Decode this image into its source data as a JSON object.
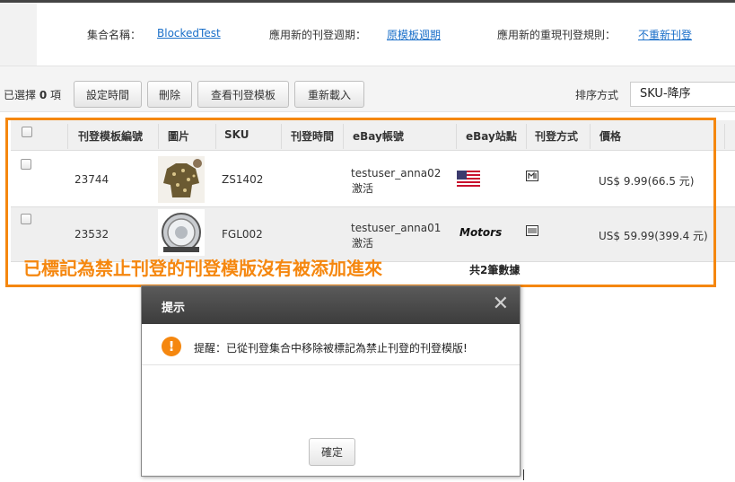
{
  "header": {
    "collection_label": "集合名稱：",
    "collection_value": "BlockedTest",
    "cycle_label": "應用新的刊登週期：",
    "cycle_value": "原模板週期",
    "rule_label": "應用新的重現刊登規則：",
    "rule_value": "不重新刊登"
  },
  "toolbar": {
    "selected_prefix": "已選擇",
    "selected_count": "0",
    "selected_suffix": "項",
    "buttons": [
      "設定時間",
      "刪除",
      "查看刊登模板",
      "重新載入"
    ],
    "sort_label": "排序方式",
    "sort_value": "SKU-降序"
  },
  "table": {
    "columns": [
      "刊登模板編號",
      "圖片",
      "SKU",
      "刊登時間",
      "eBay帳號",
      "eBay站點",
      "刊登方式",
      "價格"
    ],
    "rows": [
      {
        "id": "23744",
        "sku": "ZS1402",
        "account": "testuser_anna02",
        "status": "激活",
        "site_icon": "us-flag-icon",
        "method_icon": "fixed-price-icon",
        "price": "US$ 9.99(66.5 元)"
      },
      {
        "id": "23532",
        "sku": "FGL002",
        "account": "testuser_anna01",
        "status": "激活",
        "site_logo": "Motors",
        "method_icon": "multi-variation-icon",
        "price": "US$ 59.99(399.4 元)"
      }
    ],
    "total": "共2筆數據"
  },
  "annotation": "已標記為禁止刊登的刊登模版沒有被添加進來",
  "dialog": {
    "title": "提示",
    "close": "✕",
    "message": "提醒：已從刊登集合中移除被標記為禁止刊登的刊登模版!",
    "ok_label": "確定"
  },
  "colors": {
    "accent_orange": "#f5870f",
    "link_blue": "#1a6fc9"
  }
}
